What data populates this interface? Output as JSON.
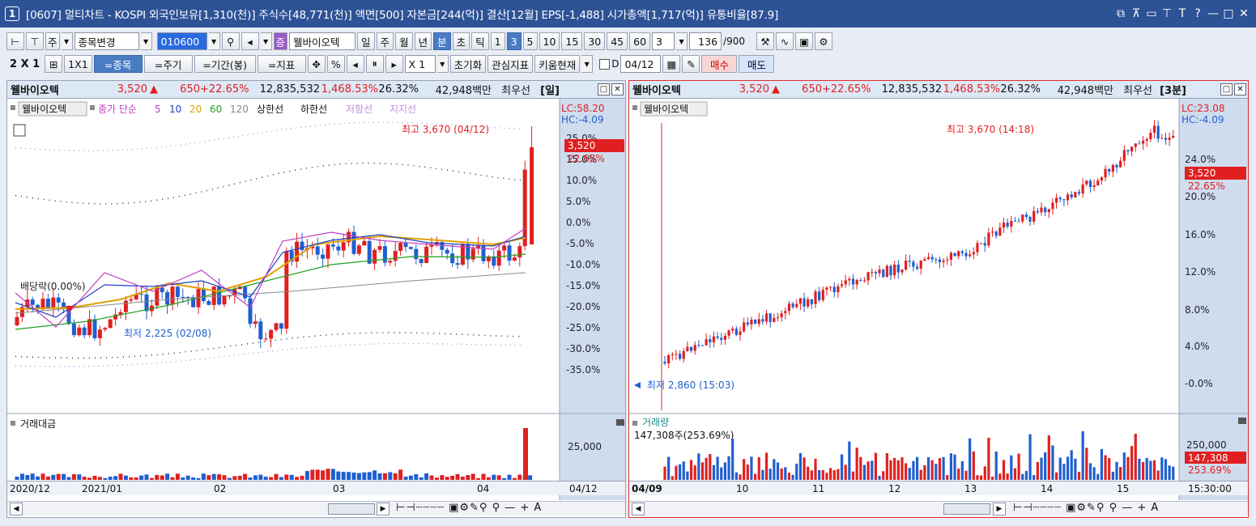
{
  "window": {
    "number": "1",
    "title": "[0607] 멀티차트 - KOSPI 외국인보유[1,310(천)] 주식수[48,771(천)] 액면[500] 자본금[244(억)] 결산[12월] EPS[-1,488] 시가총액[1,717(억)] 유통비율[87.9]",
    "title_buttons": [
      "⊡",
      "⊤",
      "⊡",
      "T",
      "T",
      "?",
      "—",
      "□",
      "✕"
    ]
  },
  "toolbar1": {
    "market": "주",
    "stock_change": "종목변경",
    "code": "010600",
    "stock_badge": "증",
    "stock_name": "웰바이오텍",
    "periods": [
      "일",
      "주",
      "월",
      "년",
      "분",
      "초",
      "틱"
    ],
    "selected_period": "분",
    "intervals": [
      "1",
      "3",
      "5",
      "10",
      "15",
      "30",
      "45",
      "60"
    ],
    "selected_interval": "3",
    "count_select": "3",
    "count": "136",
    "count_total": "/900"
  },
  "toolbar2": {
    "layout": "2 X 1",
    "layout_btn": "1X1",
    "tabs": [
      "=종목",
      "=주기",
      "=기간(봉)",
      "=지표"
    ],
    "selected_tab": "=종목",
    "percent": "%",
    "multiplier": "X 1",
    "reset": "초기화",
    "interest": "관심지표",
    "kiwoom": "키움현재",
    "checkbox_label": "D",
    "date": "04/12",
    "buy": "매수",
    "sell": "매도"
  },
  "left_panel": {
    "header": {
      "name": "웰바이오텍",
      "price": "3,520",
      "arrow": "▲",
      "change": "650",
      "change_pct": "+22.65%",
      "volume": "12,835,532",
      "vol_pct": "1,468.53%",
      "turnover": "26.32%",
      "amount": "42,948백만",
      "best": "최우선",
      "period": "[일]"
    },
    "legend": {
      "stock": "웰바이오텍",
      "ma_label": "종가 단순",
      "ma": [
        "5",
        "10",
        "20",
        "60",
        "120"
      ],
      "upper": "상한선",
      "lower": "하한선",
      "resist": "저항선",
      "support": "지지선"
    },
    "lc": "LC:58.20",
    "hc": "HC:-4.09",
    "price_tag": "3,520",
    "pct_tag": "22.65%",
    "max_label": "최고 3,670 (04/12)",
    "min_label": "최저 2,225 (02/08)",
    "ex_label": "배당락(0.00%)",
    "volume_label": "거래대금",
    "vol_axis": "25,000",
    "xaxis": [
      "2020/12",
      "2021/01",
      "02",
      "03",
      "04",
      "04/12"
    ]
  },
  "right_panel": {
    "header": {
      "name": "웰바이오텍",
      "price": "3,520",
      "arrow": "▲",
      "change": "650",
      "change_pct": "+22.65%",
      "volume": "12,835,532",
      "vol_pct": "1,468.53%",
      "turnover": "26.32%",
      "amount": "42,948백만",
      "best": "최우선",
      "period": "[3분]"
    },
    "legend": {
      "stock": "웰바이오텍"
    },
    "lc": "LC:23.08",
    "hc": "HC:-4.09",
    "price_tag": "3,520",
    "pct_tag": "22.65%",
    "max_label": "최고 3,670 (14:18)",
    "min_label": "최저 2,860 (15:03)",
    "volume_label": "거래량",
    "volume_value": "147,308주(253.69%)",
    "vol_axis": "250,000",
    "vol_tag": "147,308",
    "vol_pct_tag": "253.69%",
    "xaxis": [
      "04/09",
      "10",
      "11",
      "12",
      "13",
      "14",
      "15",
      "15:30:00"
    ]
  },
  "left_yaxis": [
    "25.0%",
    "15.0%",
    "10.0%",
    "5.0%",
    "0.0%",
    "-5.0%",
    "-10.0%",
    "-15.0%",
    "-20.0%",
    "-25.0%",
    "-30.0%",
    "-35.0%"
  ],
  "right_yaxis": [
    "24.0%",
    "20.0%",
    "16.0%",
    "12.0%",
    "8.0%",
    "4.0%",
    "-0.0%"
  ],
  "colors": {
    "up": "#e02020",
    "down": "#1f5fd0",
    "ma5": "#c040c0",
    "ma10": "#2040c0",
    "ma20": "#e0a000",
    "ma60": "#20a020",
    "ma120": "#888888"
  }
}
